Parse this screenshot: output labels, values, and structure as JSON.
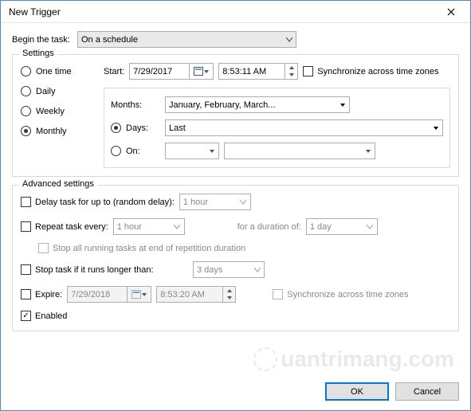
{
  "title": "New Trigger",
  "begin": {
    "label": "Begin the task:",
    "value": "On a schedule"
  },
  "settings": {
    "legend": "Settings",
    "frequency": {
      "one_time": "One time",
      "daily": "Daily",
      "weekly": "Weekly",
      "monthly": "Monthly",
      "selected": "monthly"
    },
    "start": {
      "label": "Start:",
      "date": "7/29/2017",
      "time": "8:53:11 AM",
      "sync_label": "Synchronize across time zones"
    },
    "months": {
      "label": "Months:",
      "value": "January, February, March..."
    },
    "days": {
      "label": "Days:",
      "value": "Last",
      "selected": true
    },
    "on": {
      "label": "On:",
      "val1": "",
      "val2": "",
      "selected": false
    }
  },
  "advanced": {
    "legend": "Advanced settings",
    "delay": {
      "label": "Delay task for up to (random delay):",
      "value": "1 hour"
    },
    "repeat": {
      "label": "Repeat task every:",
      "value": "1 hour",
      "duration_label": "for a duration of:",
      "duration_value": "1 day"
    },
    "stop_repetition": "Stop all running tasks at end of repetition duration",
    "stop_longer": {
      "label": "Stop task if it runs longer than:",
      "value": "3 days"
    },
    "expire": {
      "label": "Expire:",
      "date": "7/29/2018",
      "time": "8:53:20 AM",
      "sync_label": "Synchronize across time zones"
    },
    "enabled": {
      "label": "Enabled",
      "checked": true
    }
  },
  "buttons": {
    "ok": "OK",
    "cancel": "Cancel"
  },
  "watermark": "uantrimang.com"
}
